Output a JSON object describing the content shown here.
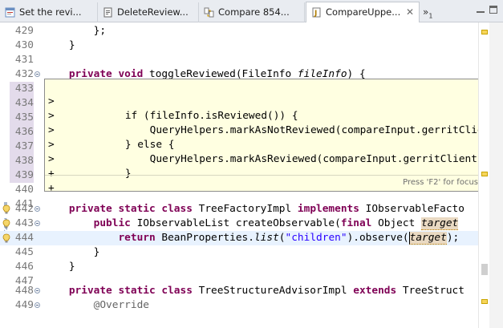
{
  "tabs": [
    {
      "label": "Set the revi...",
      "icon": "web-page-icon",
      "active": false
    },
    {
      "label": "DeleteReview...",
      "icon": "editor-page-icon",
      "active": false
    },
    {
      "label": "Compare 854...",
      "icon": "compare-icon",
      "active": false
    },
    {
      "label": "CompareUppe...",
      "icon": "java-file-icon",
      "active": true
    }
  ],
  "tab_close_glyph": "✕",
  "overflow": {
    "glyph": "»",
    "count": "1"
  },
  "editor": {
    "lines": [
      {
        "num": "429"
      },
      {
        "num": "430"
      },
      {
        "num": "431"
      },
      {
        "num": "432"
      },
      {
        "num": "433"
      },
      {
        "num": "434"
      },
      {
        "num": "435"
      },
      {
        "num": "436"
      },
      {
        "num": "437"
      },
      {
        "num": "438"
      },
      {
        "num": "439"
      },
      {
        "num": "440"
      },
      {
        "num": "441"
      },
      {
        "num": "442"
      },
      {
        "num": "443"
      },
      {
        "num": "444"
      },
      {
        "num": "445"
      },
      {
        "num": "446"
      },
      {
        "num": "447"
      },
      {
        "num": "448"
      },
      {
        "num": "449"
      }
    ],
    "code": {
      "l429": "        };",
      "l430": "    }",
      "l432_kw": "private void",
      "l432_a": " toggleReviewed(FileInfo ",
      "l432_p": "fileInfo",
      "l432_b": ") {",
      "l442_kw": "private static class",
      "l442_a": " TreeFactoryImpl ",
      "l442_kw2": "implements",
      "l442_b": " IObservableFacto",
      "l443_kw": "public",
      "l443_a": " IObservableList createObservable(",
      "l443_kw2": "final",
      "l443_b": " Object ",
      "l443_p": "target",
      "l444_kw": "return",
      "l444_a": " BeanProperties.",
      "l444_i": "list",
      "l444_b": "(",
      "l444_s": "\"children\"",
      "l444_c": ").observe(",
      "l444_p": "target",
      "l444_d": ");",
      "l445": "        }",
      "l446": "    }",
      "l448_kw": "private static class",
      "l448_a": " TreeStructureAdvisorImpl ",
      "l448_kw2": "extends",
      "l448_b": " TreeStruct",
      "l449": "@Override"
    }
  },
  "popup": {
    "lines": [
      {
        "mark": ">",
        "code": "    if (fileInfo.isReviewed()) {"
      },
      {
        "mark": ">",
        "code": "        QueryHelpers.markAsNotReviewed(compareInput.gerritClient"
      },
      {
        "mark": ">",
        "code": "    } else {"
      },
      {
        "mark": ">",
        "code": "        QueryHelpers.markAsReviewed(compareInput.gerritClient, "
      },
      {
        "mark": ">",
        "code": "    }"
      },
      {
        "mark": "+",
        "code": ""
      },
      {
        "mark": "+",
        "code": ""
      }
    ],
    "status": "Press 'F2' for focus"
  },
  "colors": {
    "keyword": "#7f0055",
    "string": "#2a00ff",
    "popup_bg": "#ffffe1",
    "current_line": "#e8f2fe",
    "occurrence": "#e9d9c2",
    "warning_marker": "#f6d55c"
  }
}
